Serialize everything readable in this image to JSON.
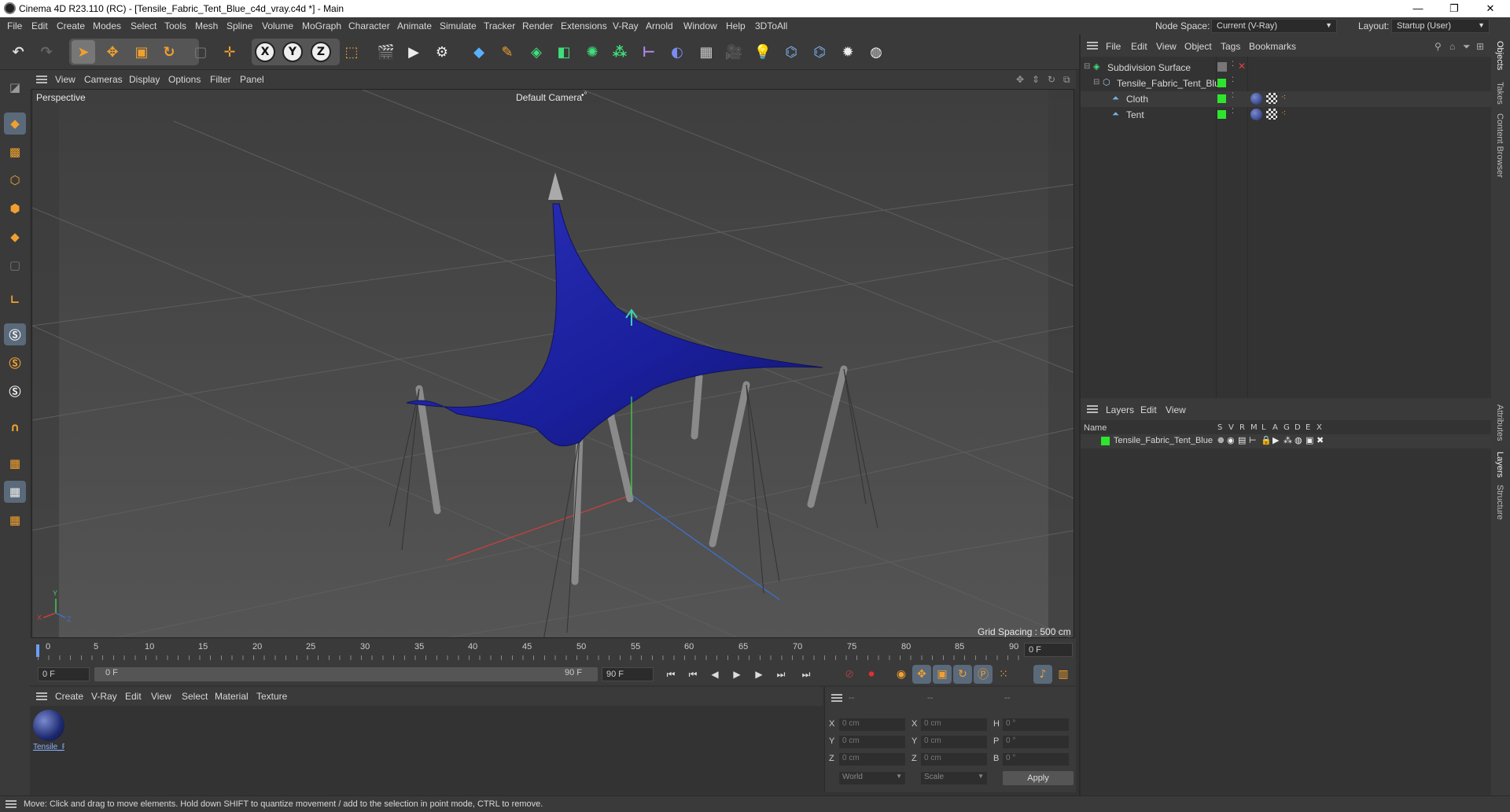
{
  "window": {
    "title": "Cinema 4D R23.110 (RC) - [Tensile_Fabric_Tent_Blue_c4d_vray.c4d *] - Main",
    "minimize": "—",
    "maximize": "❐",
    "close": "✕"
  },
  "menubar": {
    "items": [
      "File",
      "Edit",
      "Create",
      "Modes",
      "Select",
      "Tools",
      "Mesh",
      "Spline",
      "Volume",
      "MoGraph",
      "Character",
      "Animate",
      "Simulate",
      "Tracker",
      "Render",
      "Extensions",
      "V-Ray",
      "Arnold",
      "Window",
      "Help",
      "3DToAll"
    ],
    "node_space_label": "Node Space:",
    "node_space_value": "Current (V-Ray)",
    "layout_label": "Layout:",
    "layout_value": "Startup (User)"
  },
  "toolbar": {
    "axis_x": "X",
    "axis_y": "Y",
    "axis_z": "Z"
  },
  "viewport": {
    "menu": [
      "View",
      "Cameras",
      "Display",
      "Options",
      "Filter",
      "Panel"
    ],
    "view_name": "Perspective",
    "camera_name": "Default Camera",
    "camera_suffix": "•°",
    "grid_spacing": "Grid Spacing : 500 cm",
    "axis_labels": {
      "x": "X",
      "y": "Y",
      "z": "Z"
    }
  },
  "timeline": {
    "ticks": [
      "0",
      "5",
      "10",
      "15",
      "20",
      "25",
      "30",
      "35",
      "40",
      "45",
      "50",
      "55",
      "60",
      "65",
      "70",
      "75",
      "80",
      "85",
      "90"
    ],
    "current_frame_display": "0 F"
  },
  "transport": {
    "start_field": "0 F",
    "range_start": "0 F",
    "range_end": "90 F",
    "end_field": "90 F"
  },
  "material_panel": {
    "menu": [
      "Create",
      "V-Ray",
      "Edit",
      "View",
      "Select",
      "Material",
      "Texture"
    ],
    "materials": [
      {
        "name": "Tensile_F"
      }
    ]
  },
  "coordinates": {
    "headers": [
      "--",
      "--",
      "--"
    ],
    "rows": [
      {
        "l1": "X",
        "v1": "0 cm",
        "l2": "X",
        "v2": "0 cm",
        "l3": "H",
        "v3": "0 °"
      },
      {
        "l1": "Y",
        "v1": "0 cm",
        "l2": "Y",
        "v2": "0 cm",
        "l3": "P",
        "v3": "0 °"
      },
      {
        "l1": "Z",
        "v1": "0 cm",
        "l2": "Z",
        "v2": "0 cm",
        "l3": "B",
        "v3": "0 °"
      }
    ],
    "mode_select": "World",
    "scale_select": "Scale",
    "apply": "Apply"
  },
  "status": {
    "text": "Move: Click and drag to move elements. Hold down SHIFT to quantize movement / add to the selection in point mode, CTRL to remove."
  },
  "object_manager": {
    "menu": [
      "File",
      "Edit",
      "View",
      "Object",
      "Tags",
      "Bookmarks"
    ],
    "objects": [
      {
        "name": "Subdivision Surface"
      },
      {
        "name": "Tensile_Fabric_Tent_Blue"
      },
      {
        "name": "Cloth"
      },
      {
        "name": "Tent"
      }
    ]
  },
  "layer_manager": {
    "menu": [
      "Layers",
      "Edit",
      "View"
    ],
    "header_name": "Name",
    "flags": [
      "S",
      "V",
      "R",
      "M",
      "L",
      "A",
      "G",
      "D",
      "E",
      "X"
    ],
    "layers": [
      {
        "name": "Tensile_Fabric_Tent_Blue",
        "color": "#2ee52e"
      }
    ]
  },
  "side_tabs": [
    "Objects",
    "Takes",
    "Content Browser",
    "Attributes",
    "Layers",
    "Structure"
  ],
  "colors": {
    "accent_green": "#2ee52e",
    "tent_fabric": "#1a1f9c",
    "ui_bg": "#3a3a3a"
  }
}
